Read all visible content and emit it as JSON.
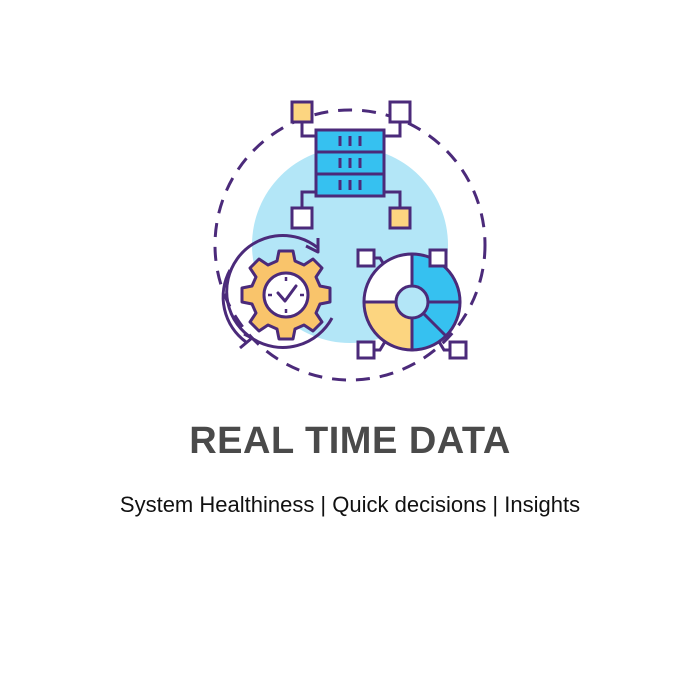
{
  "heading": {
    "title": "REAL TIME DATA",
    "subtitle": "System Healthiness | Quick decisions | Insights"
  },
  "illustration": {
    "icons": [
      "server-icon",
      "gear-clock-icon",
      "pie-chart-icon"
    ],
    "colors": {
      "outline": "#4b2a7a",
      "bg_circle": "#b3e6f7",
      "blue": "#36c1f0",
      "yellow": "#fcd580",
      "orange": "#f9c46b"
    }
  }
}
